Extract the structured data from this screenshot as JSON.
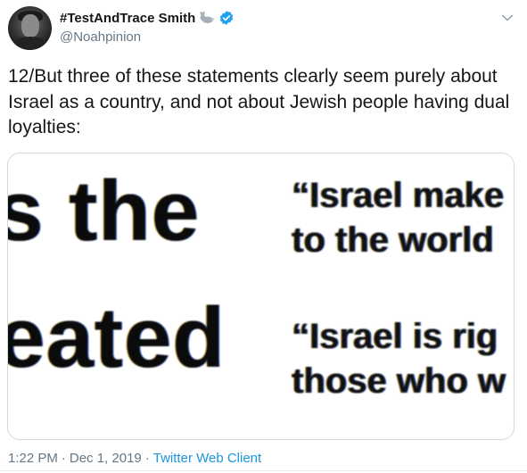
{
  "author": {
    "display_name": "#TestAndTrace Smith",
    "handle": "@Noahpinion",
    "emoji_icon": "rabbit-icon",
    "verified_icon": "verified-badge-icon"
  },
  "tweet": {
    "text": "12/But three of these statements clearly seem purely about Israel as a country, and not about Jewish people having dual loyalties:"
  },
  "media": {
    "left_fragment_1": "s the",
    "left_fragment_2": "eated",
    "quote_1": "“Israel make\nto the world",
    "quote_2": "“Israel is rig\nthose who w"
  },
  "meta": {
    "time": "1:22 PM",
    "separator": "·",
    "date": "Dec 1, 2019",
    "client": "Twitter Web Client"
  },
  "colors": {
    "link_blue": "#1b95e0",
    "verified_blue": "#1da1f2",
    "muted_text": "#657786"
  }
}
